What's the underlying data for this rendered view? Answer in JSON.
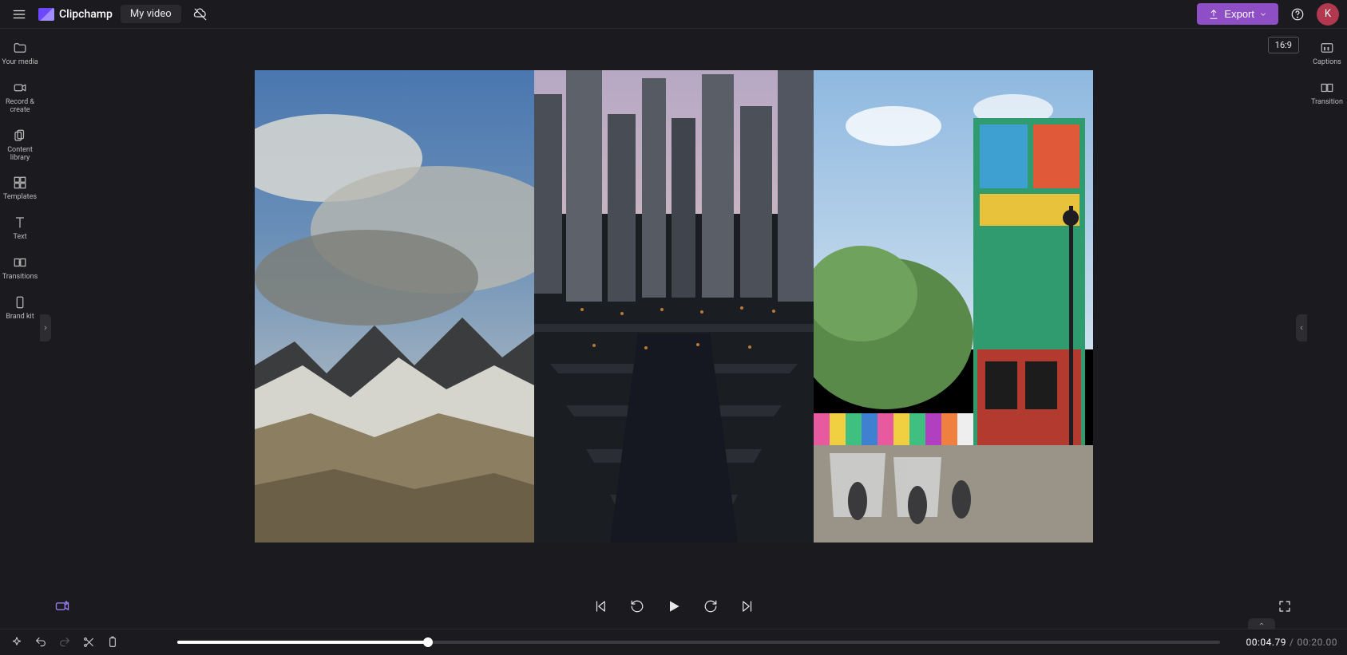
{
  "app": {
    "name": "Clipchamp"
  },
  "header": {
    "project_title": "My video",
    "export_label": "Export",
    "avatar_initial": "K"
  },
  "left_rail": {
    "items": [
      {
        "label": "Your media",
        "icon": "folder-icon"
      },
      {
        "label": "Record & create",
        "icon": "camera-icon"
      },
      {
        "label": "Content library",
        "icon": "library-icon"
      },
      {
        "label": "Templates",
        "icon": "templates-icon"
      },
      {
        "label": "Text",
        "icon": "text-icon"
      },
      {
        "label": "Transitions",
        "icon": "transitions-icon"
      },
      {
        "label": "Brand kit",
        "icon": "brandkit-icon"
      }
    ]
  },
  "right_rail": {
    "items": [
      {
        "label": "Captions",
        "icon": "captions-icon"
      },
      {
        "label": "Transition",
        "icon": "transition-icon"
      }
    ]
  },
  "preview": {
    "aspect_ratio": "16:9",
    "panels": [
      {
        "name": "mountain-landscape",
        "description": "Snowy mountains under cloudy sky"
      },
      {
        "name": "city-aerial",
        "description": "City waterfront with bridges and tall buildings at dusk"
      },
      {
        "name": "colorful-street",
        "description": "Colorful building facade on a busy street with trees"
      }
    ]
  },
  "timeline": {
    "current_time": "00:04.79",
    "total_time": "00:20.00",
    "progress_percent": 24
  }
}
